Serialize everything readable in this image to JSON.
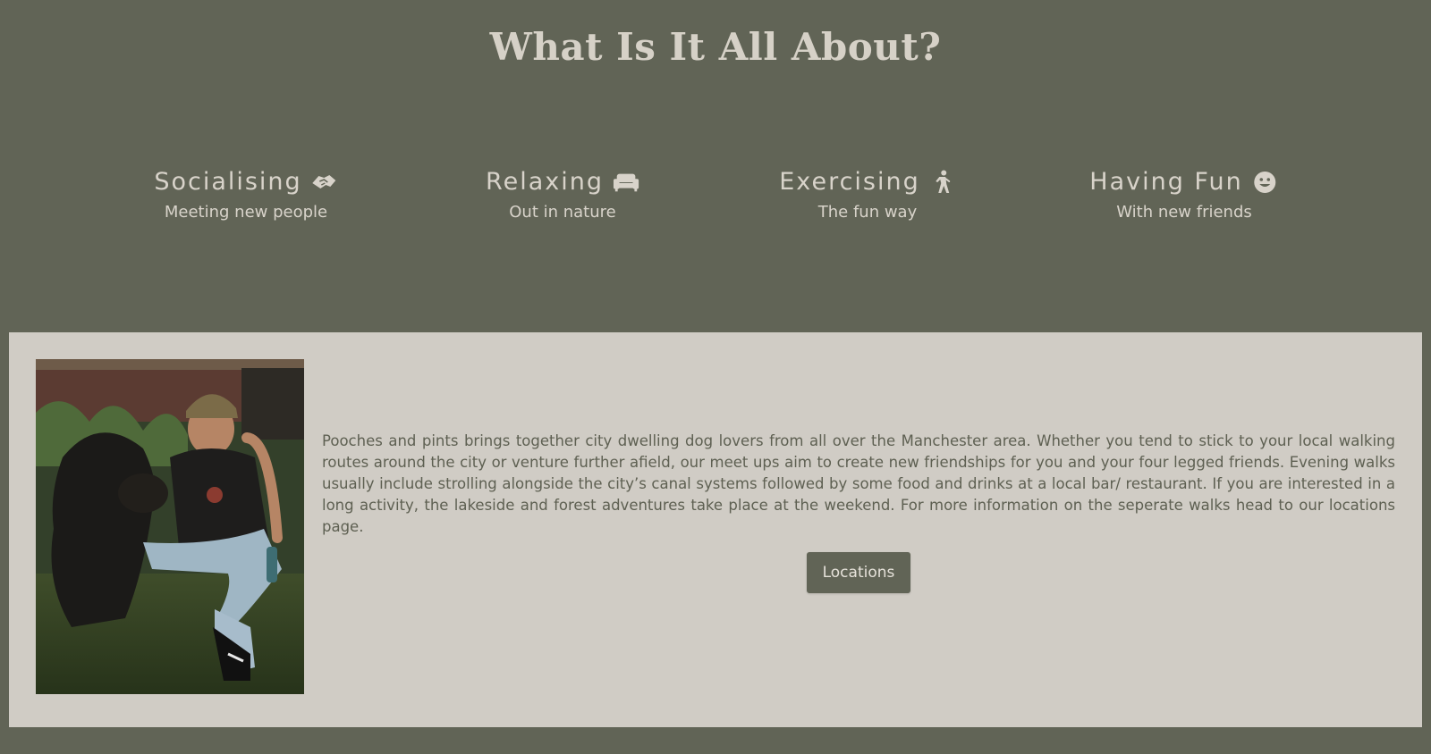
{
  "header": {
    "title": "What Is It All About?"
  },
  "features": [
    {
      "title": "Socialising",
      "subtitle": "Meeting new people",
      "icon": "handshake-icon"
    },
    {
      "title": "Relaxing",
      "subtitle": "Out in nature",
      "icon": "couch-icon"
    },
    {
      "title": "Exercising",
      "subtitle": "The fun way",
      "icon": "walking-person-icon"
    },
    {
      "title": "Having Fun",
      "subtitle": "With new friends",
      "icon": "smiley-face-icon"
    }
  ],
  "about": {
    "image_icon": "man-with-dog-photo",
    "text": "Pooches and pints brings together city dwelling dog lovers from all over the Manchester area. Whether you tend to stick to your local walking routes around the city or venture further afield, our meet ups aim to create new friendships for you and your four legged friends. Evening walks usually include strolling alongside the city’s canal systems followed by some food and drinks at a local bar/ restaurant. If you are interested in a long activity, the lakeside and forest adventures take place at the weekend. For more information on the seperate walks head to our locations page.",
    "button_label": "Locations"
  },
  "colors": {
    "background": "#616456",
    "panel": "#d0ccc5",
    "heading_text": "#d6d1c7",
    "body_text": "#5e6052",
    "button_bg": "#616456"
  }
}
